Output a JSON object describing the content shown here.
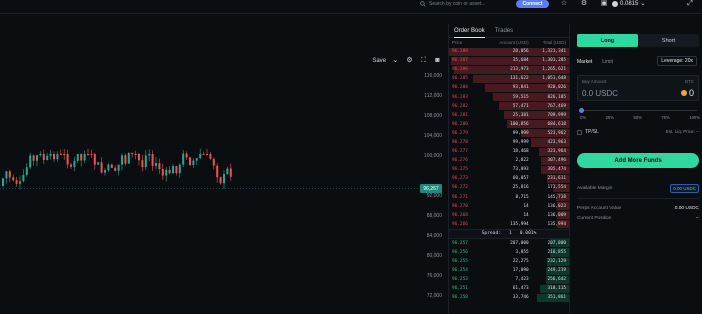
{
  "topbar": {
    "search_placeholder": "Search by coin or asset...",
    "connect_label": "Connect",
    "balance": "0.0815",
    "icons": [
      "search-icon",
      "star-icon",
      "gear-icon",
      "wallet-icon",
      "expand-icon"
    ]
  },
  "chart": {
    "save_label": "Save",
    "y_ticks": [
      "116,000",
      "112,000",
      "108,000",
      "104,000",
      "100,000",
      "92,000",
      "88,000",
      "84,000",
      "80,000",
      "76,000",
      "72,000"
    ],
    "current_price": "96,267"
  },
  "orderbook": {
    "tabs": [
      "Order Book",
      "Trades"
    ],
    "headers": [
      "Price",
      "Amount (USD)",
      "Total (USD)"
    ],
    "asks": [
      {
        "price": "96.288",
        "amount": "20,056",
        "total": "1,321,341",
        "depth": 1.0
      },
      {
        "price": "96.287",
        "amount": "35,684",
        "total": "1,301,285",
        "depth": 0.98
      },
      {
        "price": "96.286",
        "amount": "213,973",
        "total": "1,265,621",
        "depth": 0.96
      },
      {
        "price": "96.285",
        "amount": "131,622",
        "total": "1,051,648",
        "depth": 0.8
      },
      {
        "price": "96.284",
        "amount": "93,841",
        "total": "920,026",
        "depth": 0.7
      },
      {
        "price": "96.283",
        "amount": "59,515",
        "total": "826,185",
        "depth": 0.63
      },
      {
        "price": "96.282",
        "amount": "57,471",
        "total": "767,469",
        "depth": 0.58
      },
      {
        "price": "96.281",
        "amount": "25,381",
        "total": "709,999",
        "depth": 0.54
      },
      {
        "price": "96.280",
        "amount": "100,856",
        "total": "684,618",
        "depth": 0.52
      },
      {
        "price": "96.279",
        "amount": "99,999",
        "total": "523,962",
        "depth": 0.4
      },
      {
        "price": "96.278",
        "amount": "99,999",
        "total": "423,963",
        "depth": 0.32
      },
      {
        "price": "96.277",
        "amount": "18,468",
        "total": "323,964",
        "depth": 0.25
      },
      {
        "price": "96.276",
        "amount": "2,822",
        "total": "307,496",
        "depth": 0.23
      },
      {
        "price": "96.275",
        "amount": "73,893",
        "total": "305,474",
        "depth": 0.23
      },
      {
        "price": "96.273",
        "amount": "60,057",
        "total": "231,611",
        "depth": 0.18
      },
      {
        "price": "96.272",
        "amount": "25,816",
        "total": "171,554",
        "depth": 0.13
      },
      {
        "price": "96.271",
        "amount": "8,715",
        "total": "145,738",
        "depth": 0.11
      },
      {
        "price": "96.270",
        "amount": "14",
        "total": "136,023",
        "depth": 0.1
      },
      {
        "price": "96.268",
        "amount": "14",
        "total": "136,009",
        "depth": 0.1
      },
      {
        "price": "96.266",
        "amount": "135,994",
        "total": "135,994",
        "depth": 0.1
      }
    ],
    "spread_label": "Spread:",
    "spread_value": "1",
    "spread_pct": "0.001%",
    "bids": [
      {
        "price": "96.257",
        "amount": "207,000",
        "total": "207,000",
        "depth": 0.16
      },
      {
        "price": "96.256",
        "amount": "3,855",
        "total": "210,855",
        "depth": 0.16
      },
      {
        "price": "96.255",
        "amount": "22,275",
        "total": "232,129",
        "depth": 0.18
      },
      {
        "price": "96.254",
        "amount": "17,090",
        "total": "249,219",
        "depth": 0.19
      },
      {
        "price": "96.253",
        "amount": "7,423",
        "total": "256,642",
        "depth": 0.19
      },
      {
        "price": "96.251",
        "amount": "61,473",
        "total": "318,115",
        "depth": 0.24
      },
      {
        "price": "96.250",
        "amount": "33,746",
        "total": "351,861",
        "depth": 0.27
      }
    ]
  },
  "panel": {
    "long_label": "Long",
    "short_label": "Short",
    "tabs": [
      "Market",
      "Limit"
    ],
    "leverage": "Leverage: 20x",
    "amount_label": "Buy Amount",
    "amount_ccy": "BTC",
    "amount_value": "0.0 USDC",
    "amount_right": "0",
    "slider_ticks": [
      "0%",
      "25%",
      "50%",
      "75%",
      "100%"
    ],
    "tpsl_label": "TP/SL",
    "est_liq": "Est. Liq. Price: --",
    "add_funds_label": "Add More Funds",
    "available_margin_label": "Available Margin",
    "available_margin_value": "0.00 USDC",
    "account_value_label": "Perps Account Value",
    "account_value_value": "0.00 USDC",
    "current_position_label": "Current Position",
    "current_position_value": "--",
    "accent": "#2fd8a0"
  }
}
